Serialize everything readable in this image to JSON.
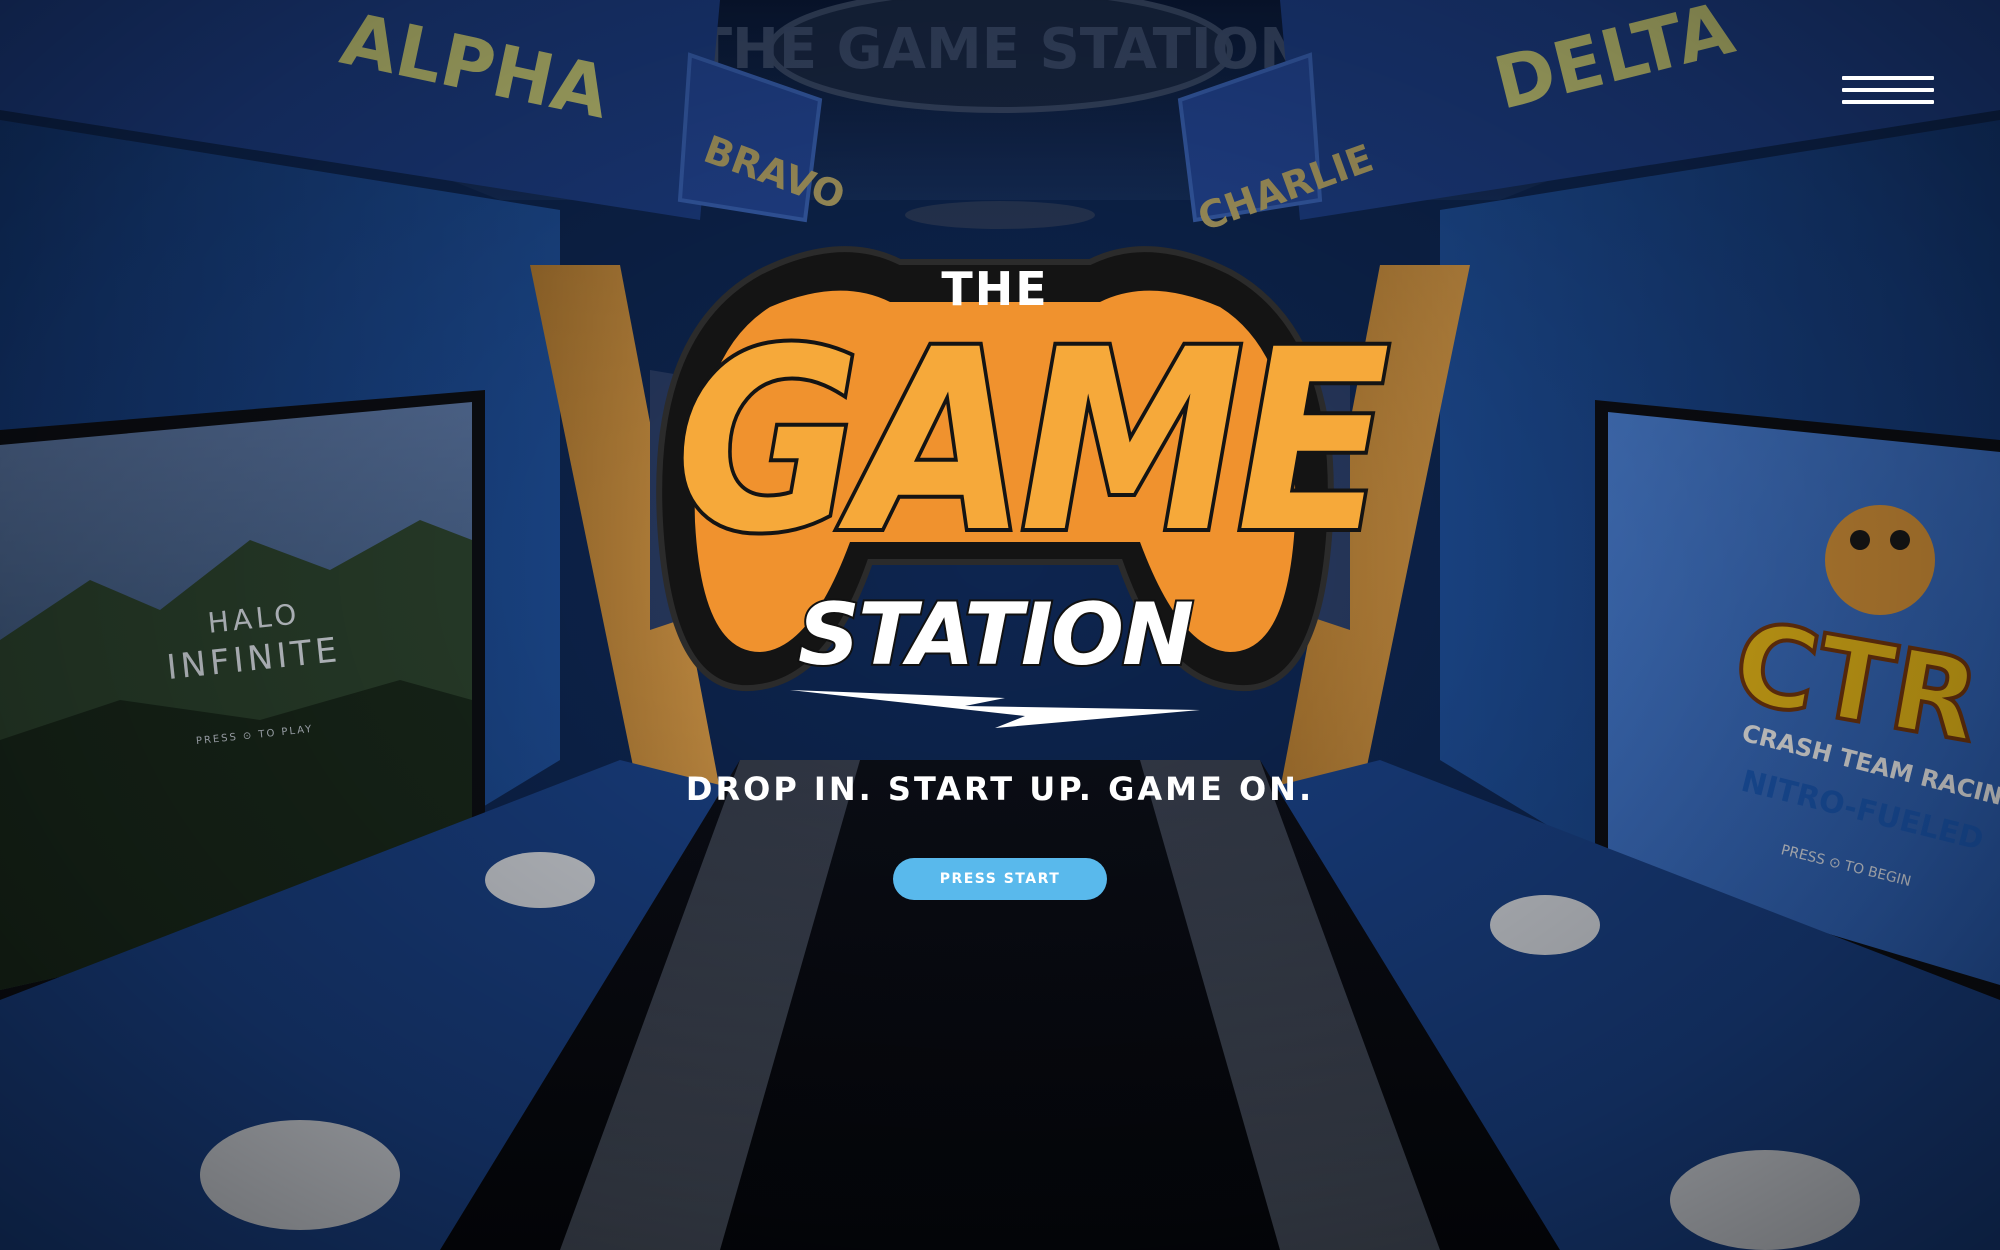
{
  "brand": {
    "logo_the": "THE",
    "logo_game": "GAME",
    "logo_station": "STATION"
  },
  "nav": {
    "menu_icon": "hamburger-menu-icon"
  },
  "hero": {
    "tagline": "DROP IN. START UP. GAME ON.",
    "cta_label": "PRESS START"
  },
  "background": {
    "bay_signs": [
      "ALPHA",
      "BRAVO",
      "CHARLIE",
      "DELTA"
    ],
    "left_screen": {
      "game_line1": "HALO",
      "game_line2": "INFINITE",
      "prompt": "PRESS ⊙ TO PLAY"
    },
    "right_screen": {
      "game_title": "CTR",
      "game_subtitle": "CRASH TEAM RACING",
      "game_tagline": "NITRO-FUELED",
      "prompt": "PRESS ⊙ TO BEGIN"
    },
    "ceiling_logo": "THE GAME STATION"
  },
  "colors": {
    "accent_orange": "#f6a93a",
    "button_blue": "#59b9ec",
    "interior_blue": "#1c4f9c"
  }
}
